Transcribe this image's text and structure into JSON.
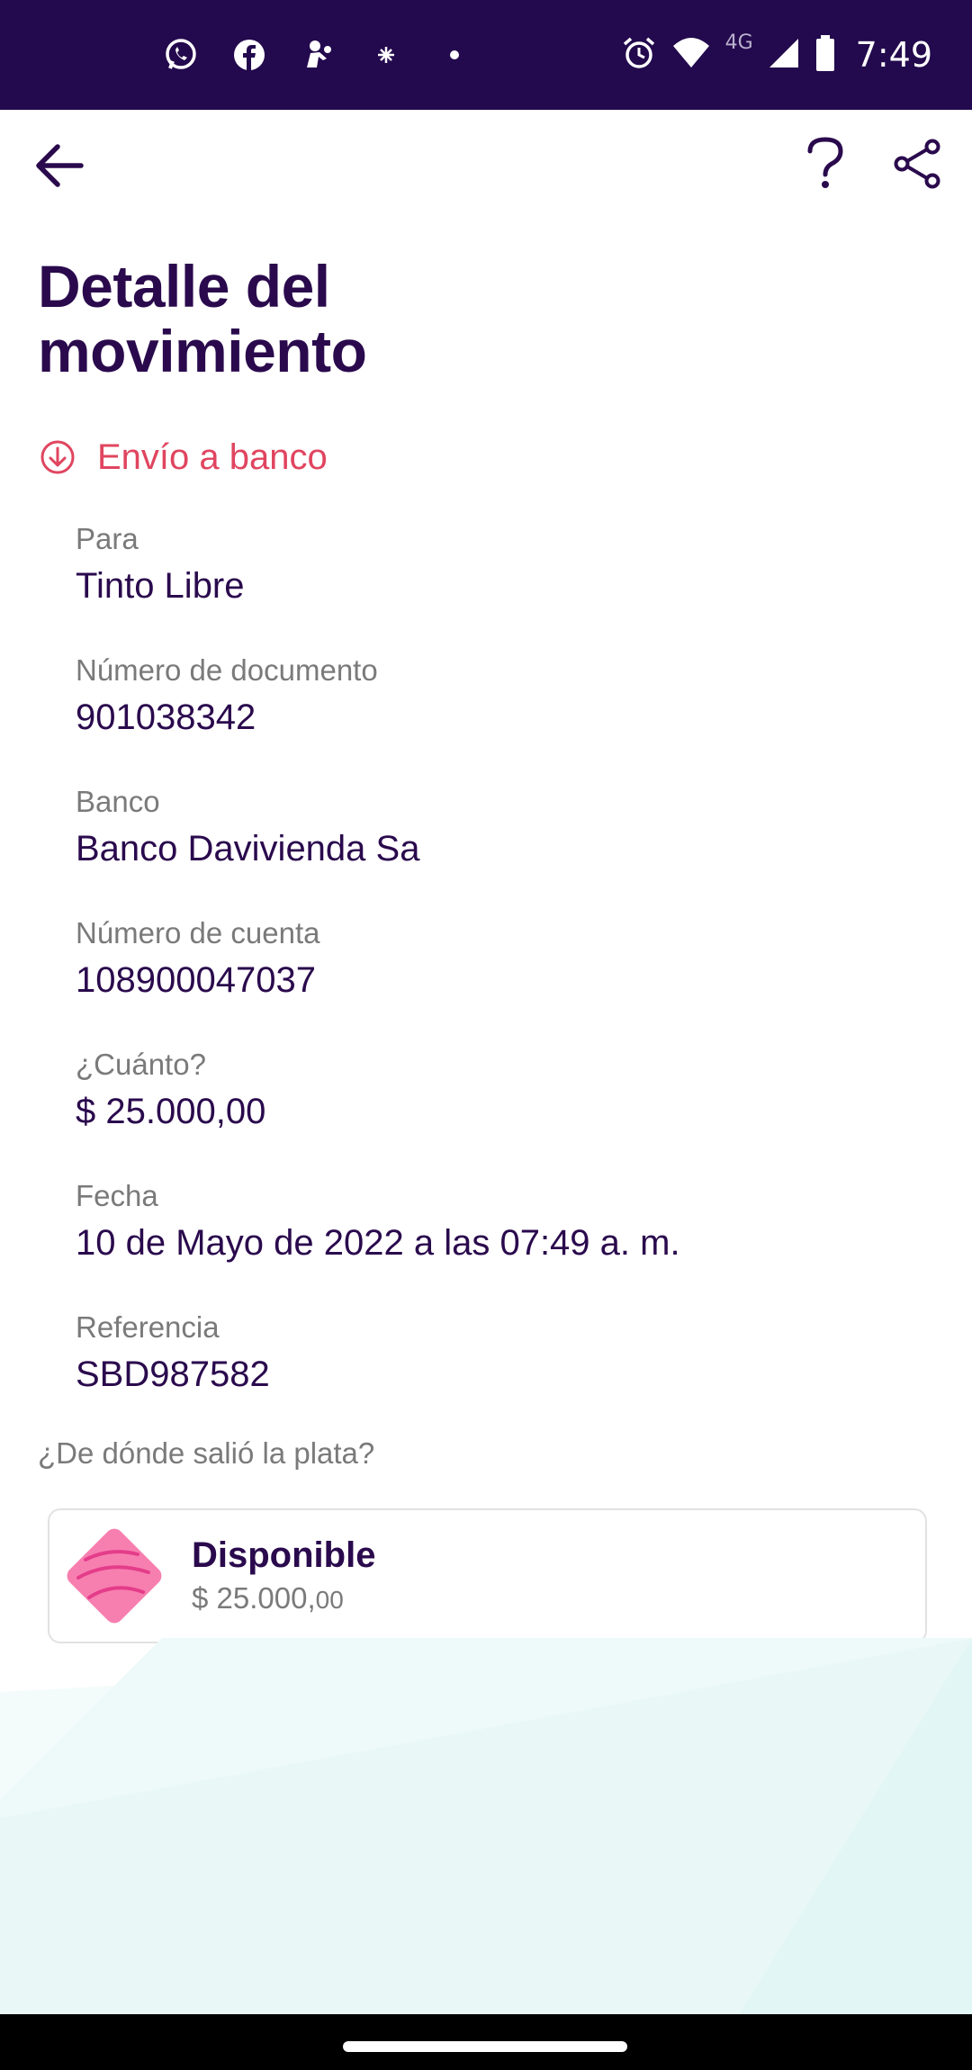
{
  "status_bar": {
    "time": "7:49",
    "network": "4G",
    "left_icons": [
      "whatsapp-icon",
      "facebook-icon",
      "app-icon",
      "sparkle-icon",
      "dot-icon"
    ],
    "right_icons": [
      "alarm-icon",
      "wifi-icon",
      "signal-icon",
      "battery-icon"
    ]
  },
  "app_bar": {
    "back_icon": "arrow-left-icon",
    "help_icon": "question-mark-icon",
    "share_icon": "share-icon"
  },
  "page": {
    "title": "Detalle del movimiento"
  },
  "movement": {
    "type_label": "Envío a banco",
    "type_icon": "arrow-down-circle-icon",
    "accent_color": "#e0455f"
  },
  "fields": [
    {
      "label": "Para",
      "value": "Tinto Libre"
    },
    {
      "label": "Número de documento",
      "value": "901038342"
    },
    {
      "label": "Banco",
      "value": "Banco Davivienda Sa"
    },
    {
      "label": "Número de cuenta",
      "value": "108900047037"
    },
    {
      "label": "¿Cuánto?",
      "value": "$ 25.000,00"
    },
    {
      "label": "Fecha",
      "value": "10 de Mayo de 2022 a las 07:49 a. m."
    },
    {
      "label": "Referencia",
      "value": "SBD987582"
    }
  ],
  "source": {
    "question": "¿De dónde salió la plata?",
    "pocket_name": "Disponible",
    "pocket_amount": "$ 25.000,",
    "pocket_cents": "00",
    "pocket_icon": "pink-pocket-icon"
  },
  "colors": {
    "brand_dark": "#23094d",
    "text_primary": "#2a0a4d",
    "text_secondary": "#7a7a7a",
    "accent": "#e0455f"
  }
}
